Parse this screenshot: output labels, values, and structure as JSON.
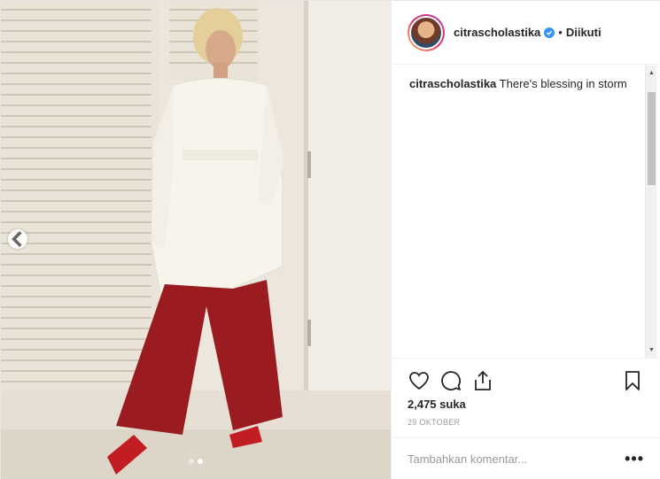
{
  "post": {
    "username": "citrascholastika",
    "verified": true,
    "separator": "•",
    "follow_status": "Diikuti",
    "caption": "There's blessing in storm",
    "likes": "2,475 suka",
    "date": "29 OKTOBER",
    "comment_placeholder": "Tambahkan komentar...",
    "more_label": "•••",
    "carousel": {
      "total": 2,
      "active": 2
    }
  },
  "icons": {
    "like": "heart-icon",
    "comment": "comment-icon",
    "share": "share-icon",
    "save": "bookmark-icon",
    "prev": "chevron-left-icon",
    "verified": "verified-badge-icon"
  },
  "colors": {
    "verified": "#3897f0",
    "text": "#262626",
    "muted": "#999999",
    "border": "#efefef"
  }
}
